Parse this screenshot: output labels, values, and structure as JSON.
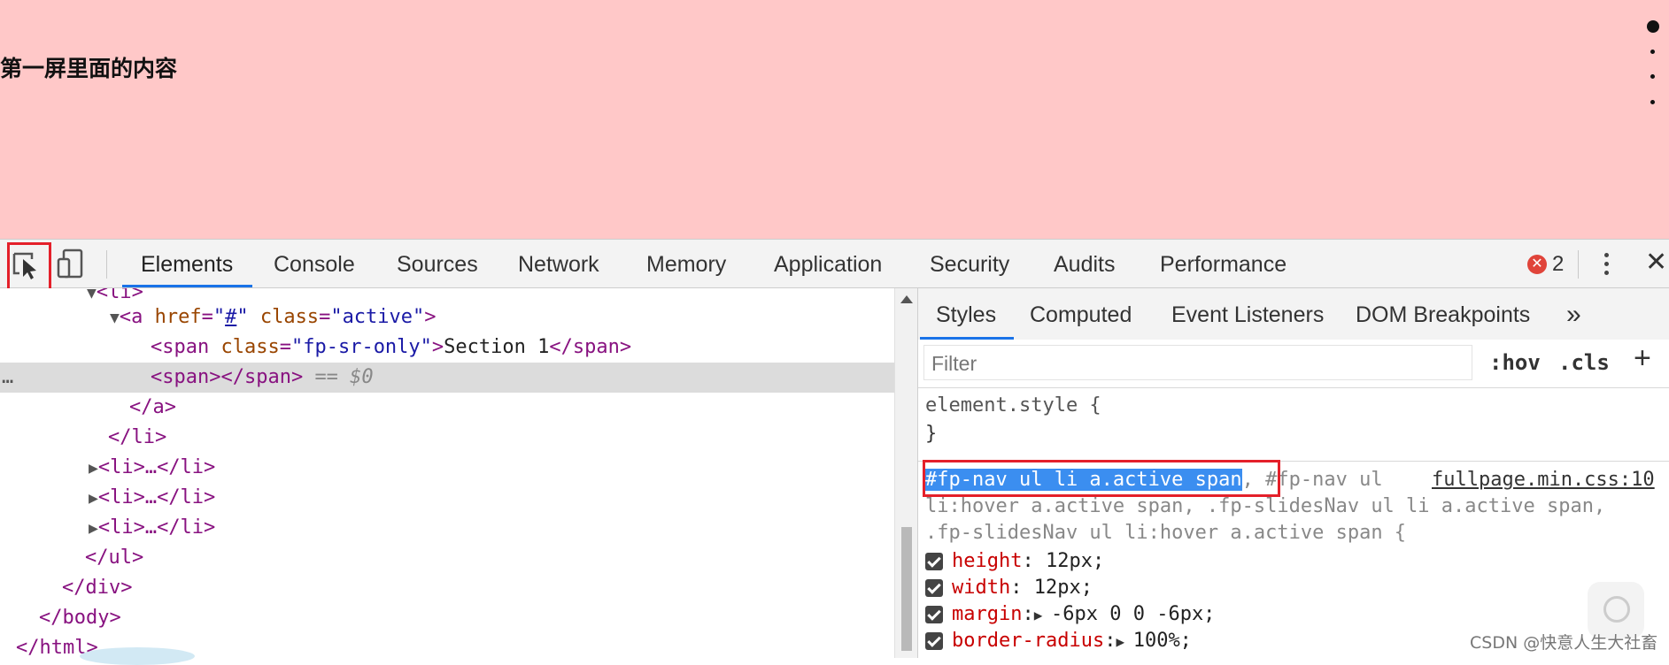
{
  "page": {
    "heading": "第一屏里面的内容",
    "background_color": "#ffc8c8",
    "nav_dots": 4
  },
  "toolbar": {
    "tabs": [
      "Elements",
      "Console",
      "Sources",
      "Network",
      "Memory",
      "Application",
      "Security",
      "Audits",
      "Performance"
    ],
    "active_tab": "Elements",
    "error_count": "2",
    "inspect_icon": "cursor-select-icon",
    "device_icon": "device-toolbar-icon",
    "close_label": "✕"
  },
  "elements": {
    "lines": [
      {
        "indent": 4,
        "tri": "▼",
        "html": "<li>"
      },
      {
        "indent": 5,
        "tri": "▼",
        "tag_open": "<a ",
        "a1": "href",
        "v1": "#",
        "a2": "class",
        "v2": "active"
      },
      {
        "indent": 7,
        "span_class": "fp-sr-only",
        "text": "Section 1"
      },
      {
        "indent": 7,
        "selected": "<span></span>",
        "marker": "== $0"
      },
      {
        "indent": 6,
        "html": "</a>"
      },
      {
        "indent": 5,
        "html": "</li>"
      },
      {
        "indent": 4,
        "tri": "▶",
        "html": "<li>…</li>"
      },
      {
        "indent": 4,
        "tri": "▶",
        "html": "<li>…</li>"
      },
      {
        "indent": 4,
        "tri": "▶",
        "html": "<li>…</li>"
      },
      {
        "indent": 4,
        "html": "</ul>"
      },
      {
        "indent": 3,
        "html": "</div>"
      },
      {
        "indent": 2,
        "html": "</body>"
      },
      {
        "indent": 1,
        "html": "</html>"
      }
    ],
    "text": {
      "l0": "<li>",
      "l1_open": "<a ",
      "l1_a1": "href",
      "l1_v1": "#",
      "l1_a2": "class",
      "l1_v2": "active",
      "l1_close": ">",
      "l2_open": "<span ",
      "l2_attr": "class",
      "l2_val": "fp-sr-only",
      "l2_text": "Section 1",
      "l2_close": "</span>",
      "l3_tag": "<span></span>",
      "l3_marker": "== $0",
      "l4": "</a>",
      "l5": "</li>",
      "l6": "<li>…</li>",
      "l7": "<li>…</li>",
      "l8": "<li>…</li>",
      "l9": "</ul>",
      "l10": "</div>",
      "l11": "</body>",
      "l12": "</html>",
      "dots": "…"
    }
  },
  "styles": {
    "subtabs": [
      "Styles",
      "Computed",
      "Event Listeners",
      "DOM Breakpoints",
      "»"
    ],
    "active_subtab": "Styles",
    "filter_placeholder": "Filter",
    "hov_label": ":hov",
    "cls_label": ".cls",
    "plus_label": "+",
    "element_style_open": "element.style {",
    "element_style_close": "}",
    "selector_matched": "#fp-nav ul li a.active span",
    "selector_rest_1": ", #fp-nav ul ",
    "selector_rest_2": "li:hover a.active span, .fp-slidesNav ul li a.active span,",
    "selector_rest_3": ".fp-slidesNav ul li:hover a.active span {",
    "source": "fullpage.min.css:10",
    "properties": [
      {
        "name": "height",
        "value": "12px;",
        "expandable": false
      },
      {
        "name": "width",
        "value": "12px;",
        "expandable": false
      },
      {
        "name": "margin",
        "value": "-6px 0 0 -6px;",
        "expandable": true
      },
      {
        "name": "border-radius",
        "value": "100%;",
        "expandable": true
      }
    ]
  },
  "watermark": "CSDN @快意人生大社畜",
  "colors": {
    "accent": "#1a73e8",
    "highlight": "#e4202a",
    "selection": "#3b8ef0"
  }
}
